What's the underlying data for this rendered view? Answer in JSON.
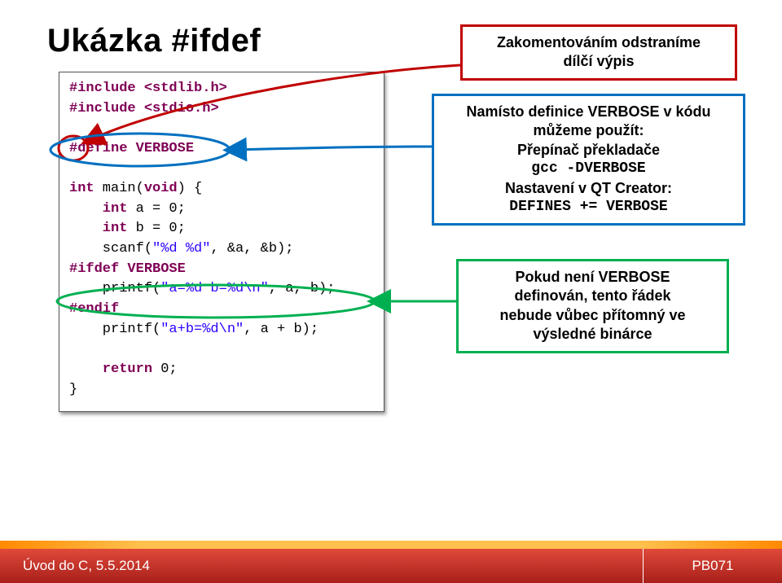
{
  "title": "Ukázka #ifdef",
  "code": {
    "include1_pre": "#include ",
    "include1_hdr": "<stdlib.h>",
    "include2_pre": "#include ",
    "include2_hdr": "<stdio.h>",
    "blank": "",
    "define": "#define VERBOSE",
    "main_sig1": "int",
    "main_sig2": " main(",
    "main_sig3": "void",
    "main_sig4": ") {",
    "decl_a1": "    int",
    "decl_a2": " a = 0;",
    "decl_b1": "    int",
    "decl_b2": " b = 0;",
    "scanf1": "    scanf(",
    "scanf_str": "\"%d %d\"",
    "scanf2": ", &a, &b);",
    "ifdef": "#ifdef VERBOSE",
    "printf1a": "    printf(",
    "printf1_str": "\"a=%d b=%d\\n\"",
    "printf1b": ", a, b);",
    "endif": "#endif",
    "printf2a": "    printf(",
    "printf2_str": "\"a+b=%d\\n\"",
    "printf2b": ", a + b);",
    "ret1": "    return",
    "ret2": " 0;",
    "brace": "}"
  },
  "annot_red": {
    "line1": "Zakomentováním odstraníme",
    "line2": "dílčí výpis"
  },
  "annot_blue": {
    "line1": "Namísto definice VERBOSE v kódu",
    "line2": "můžeme použít:",
    "line3": "Přepínač překladače",
    "line4": "gcc -DVERBOSE",
    "line5": "Nastavení v QT Creator:",
    "line6": "DEFINES += VERBOSE"
  },
  "annot_green": {
    "line1": "Pokud není VERBOSE",
    "line2": "definován, tento řádek",
    "line3": "nebude vůbec přítomný ve",
    "line4": "výsledné binárce"
  },
  "footer": {
    "left": "Úvod do C, 5.5.2014",
    "right": "PB071"
  }
}
